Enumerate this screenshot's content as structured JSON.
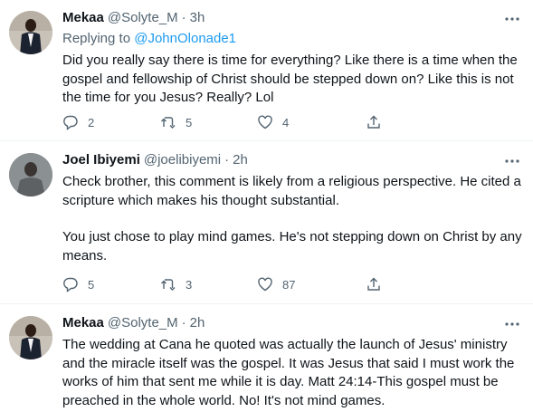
{
  "tweets": [
    {
      "name": "Mekaa",
      "handle": "@Solyte_M",
      "dot": "·",
      "time": "3h",
      "replying_prefix": "Replying to",
      "replying_to": "@JohnOlonade1",
      "text": "Did you really say there is time for everything? Like there is a time when the gospel and fellowship of Christ should be stepped down on? Like this is not the time for you Jesus? Really? Lol",
      "replies": "2",
      "retweets": "5",
      "likes": "4"
    },
    {
      "name": "Joel Ibiyemi",
      "handle": "@joelibiyemi",
      "dot": "·",
      "time": "2h",
      "text_p1": "Check brother, this comment is likely from a religious perspective. He cited a scripture which makes his thought substantial.",
      "text_p2": "You just chose to play mind games. He's not stepping down on Christ by any means.",
      "replies": "5",
      "retweets": "3",
      "likes": "87"
    },
    {
      "name": "Mekaa",
      "handle": "@Solyte_M",
      "dot": "·",
      "time": "2h",
      "text": "The wedding at Cana he quoted was actually the launch of Jesus' ministry and the miracle itself was the gospel. It was Jesus that said I must work the works of him that sent me while it is day. Matt 24:14-This gospel must be preached in the whole world. No! It's not mind games."
    }
  ],
  "colors": {
    "text": "#0f1419",
    "secondary": "#536471",
    "link": "#1d9bf0",
    "divider": "#eff3f4"
  }
}
